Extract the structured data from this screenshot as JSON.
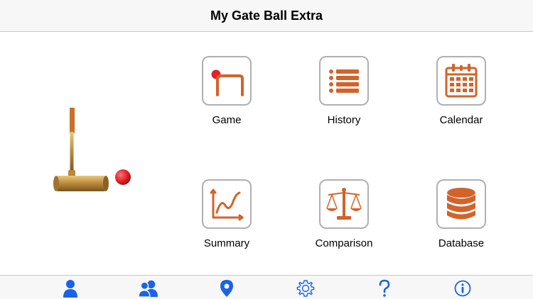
{
  "navbar": {
    "title": "My Gate Ball Extra"
  },
  "colors": {
    "accent": "#d2632a",
    "tint": "#1a63e6",
    "tile_border": "#b0b0b0",
    "ball_red": "#e0232a"
  },
  "tiles": [
    {
      "label": "Game",
      "icon": "gate-ball-icon"
    },
    {
      "label": "History",
      "icon": "list-icon"
    },
    {
      "label": "Calendar",
      "icon": "calendar-icon"
    },
    {
      "label": "Summary",
      "icon": "line-chart-icon"
    },
    {
      "label": "Comparison",
      "icon": "scales-icon"
    },
    {
      "label": "Database",
      "icon": "database-icon"
    }
  ],
  "tabbar": [
    {
      "icon": "person-icon"
    },
    {
      "icon": "people-icon"
    },
    {
      "icon": "location-pin-icon"
    },
    {
      "icon": "gear-icon"
    },
    {
      "icon": "question-mark-icon"
    },
    {
      "icon": "info-icon"
    }
  ]
}
